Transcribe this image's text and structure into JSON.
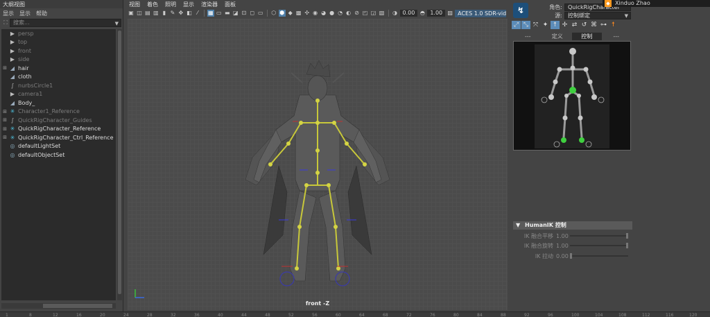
{
  "outliner": {
    "title": "大纲视图",
    "menu": [
      "显示",
      "显示",
      "帮助"
    ],
    "search_placeholder": "搜索...",
    "items": [
      {
        "label": "persp",
        "icon": "camera-icon",
        "expandable": false,
        "dim": true
      },
      {
        "label": "top",
        "icon": "camera-icon",
        "expandable": false,
        "dim": true
      },
      {
        "label": "front",
        "icon": "camera-icon",
        "expandable": false,
        "dim": true
      },
      {
        "label": "side",
        "icon": "camera-icon",
        "expandable": false,
        "dim": true
      },
      {
        "label": "hair",
        "icon": "mesh-icon",
        "expandable": true,
        "dim": false
      },
      {
        "label": "cloth",
        "icon": "mesh-icon",
        "expandable": false,
        "dim": false
      },
      {
        "label": "nurbsCircle1",
        "icon": "curve-icon",
        "expandable": false,
        "dim": true
      },
      {
        "label": "camera1",
        "icon": "camera-icon",
        "expandable": false,
        "dim": true
      },
      {
        "label": "Body_",
        "icon": "mesh-icon",
        "expandable": false,
        "dim": false
      },
      {
        "label": "Character1_Reference",
        "icon": "hik-icon",
        "expandable": true,
        "dim": true
      },
      {
        "label": "QuickRigCharacter_Guides",
        "icon": "curve-icon",
        "expandable": true,
        "dim": true
      },
      {
        "label": "QuickRigCharacter_Reference",
        "icon": "hik-icon",
        "expandable": true,
        "dim": false
      },
      {
        "label": "QuickRigCharacter_Ctrl_Reference",
        "icon": "hik-icon",
        "expandable": true,
        "dim": false
      },
      {
        "label": "defaultLightSet",
        "icon": "set-icon",
        "expandable": false,
        "dim": false
      },
      {
        "label": "defaultObjectSet",
        "icon": "set-icon",
        "expandable": false,
        "dim": false
      }
    ]
  },
  "viewport": {
    "menu": [
      "视图",
      "着色",
      "照明",
      "显示",
      "渲染器",
      "面板"
    ],
    "exposure": "0.00",
    "gamma": "1.00",
    "colorspace": "ACES 1.0 SDR-video",
    "camera_label": "front -Z"
  },
  "hik": {
    "character_label": "角色:",
    "character_value": "QuickRigCharacter",
    "source_label": "源:",
    "source_value": "控制绑定",
    "tabs": [
      "---",
      "定义",
      "控制",
      "---"
    ],
    "section_title": "HumanIK 控制",
    "sliders": [
      {
        "label": "IK 融合平移",
        "value": "1.00",
        "level": 1.0
      },
      {
        "label": "IK 融合旋转",
        "value": "1.00",
        "level": 1.0
      },
      {
        "label": "IK 拉动",
        "value": "0.00",
        "level": 0.0
      }
    ]
  },
  "user": {
    "name": "Xinduo Zhao"
  },
  "timeline": {
    "ticks": [
      "1",
      "8",
      "12",
      "16",
      "20",
      "24",
      "28",
      "32",
      "36",
      "40",
      "44",
      "48",
      "52",
      "56",
      "60",
      "64",
      "68",
      "72",
      "76",
      "80",
      "84",
      "88",
      "92",
      "96",
      "100",
      "104",
      "108",
      "112",
      "116",
      "120"
    ]
  },
  "colors": {
    "accent": "#5c8cb8",
    "hik_blue": "#4fc3e0",
    "skeleton": "#c8c83a",
    "effector": "#4ec94e"
  }
}
